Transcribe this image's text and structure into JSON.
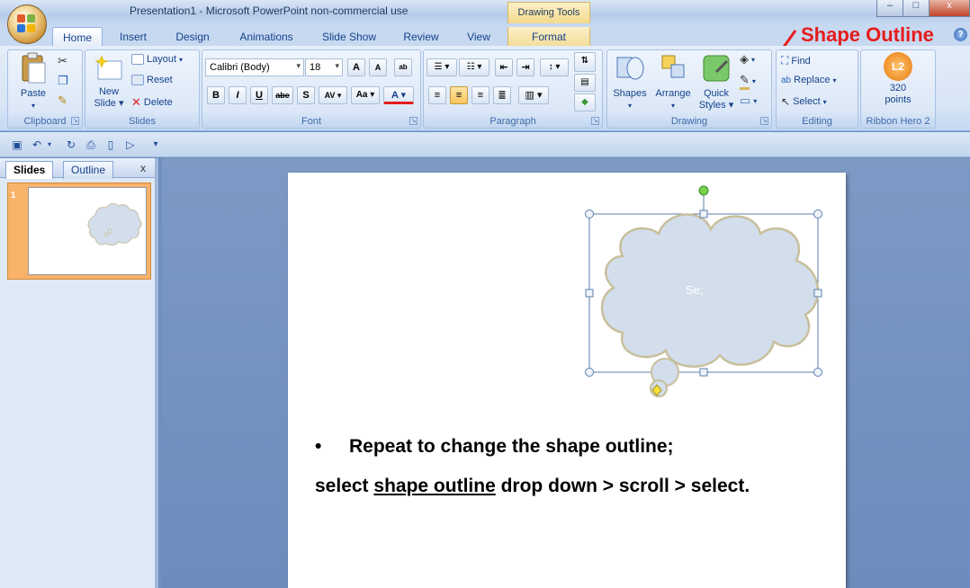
{
  "window": {
    "title": "Presentation1 - Microsoft PowerPoint non-commercial use",
    "context_tab_header": "Drawing Tools",
    "minimize": "–",
    "maximize": "□",
    "close": "x"
  },
  "tabs": [
    {
      "label": "Home"
    },
    {
      "label": "Insert"
    },
    {
      "label": "Design"
    },
    {
      "label": "Animations"
    },
    {
      "label": "Slide Show"
    },
    {
      "label": "Review"
    },
    {
      "label": "View"
    },
    {
      "label": "Format"
    }
  ],
  "annotation": {
    "callout": "Shape Outline",
    "help": "?"
  },
  "ribbon": {
    "clipboard": {
      "label": "Clipboard",
      "paste": "Paste"
    },
    "slides": {
      "label": "Slides",
      "new_slide_1": "New",
      "new_slide_2": "Slide",
      "layout": "Layout",
      "reset": "Reset",
      "delete": "Delete"
    },
    "font": {
      "label": "Font",
      "font_name": "Calibri (Body)",
      "font_size": "18",
      "bold": "B",
      "italic": "I",
      "underline": "U",
      "strike": "abe",
      "shadow": "S",
      "spacing": "AV",
      "case": "Aa",
      "color": "A",
      "grow": "A",
      "shrink": "A"
    },
    "paragraph": {
      "label": "Paragraph"
    },
    "drawing": {
      "label": "Drawing",
      "shapes": "Shapes",
      "arrange": "Arrange",
      "quick_styles_1": "Quick",
      "quick_styles_2": "Styles"
    },
    "editing": {
      "label": "Editing",
      "find": "Find",
      "replace": "Replace",
      "select": "Select"
    },
    "ribbon_hero": {
      "label": "Ribbon Hero 2",
      "points_value": "320",
      "points_label": "points",
      "badge": "L2"
    }
  },
  "pane": {
    "tab_slides": "Slides",
    "tab_outline": "Outline",
    "close": "x",
    "slide_number": "1"
  },
  "slide": {
    "shape_text": "Se;",
    "bullet": "•",
    "line1": "Repeat to change the shape outline;",
    "line2_pre": "select ",
    "line2_link": "shape outline",
    "line2_post": " drop down > scroll > select."
  }
}
